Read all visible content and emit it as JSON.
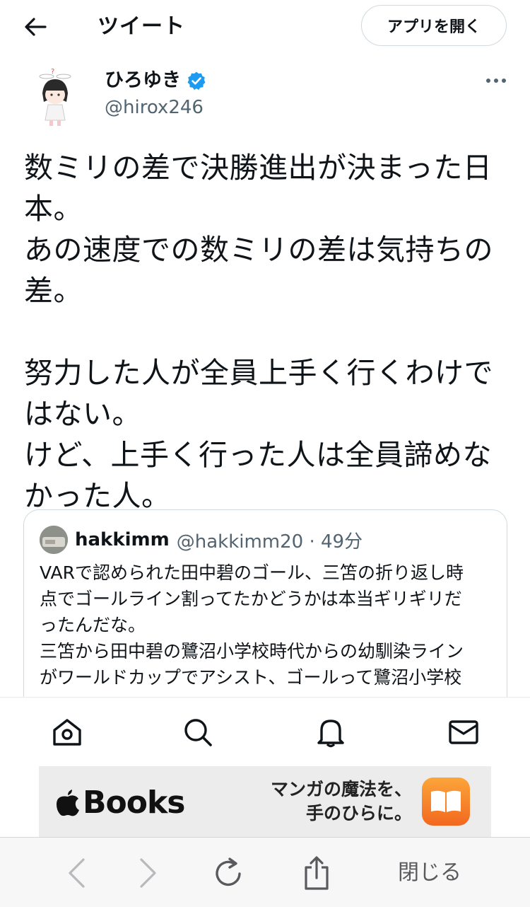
{
  "header": {
    "title": "ツイート",
    "open_app_label": "アプリを開く"
  },
  "author": {
    "name": "ひろゆき",
    "handle": "@hirox246",
    "verified": true
  },
  "tweet": {
    "lines": [
      "数ミリの差で決勝進出が決まった日",
      "本。",
      "あの速度での数ミリの差は気持ちの",
      "差。",
      "",
      "努力した人が全員上手く行くわけで",
      "はない。",
      "けど、上手く行った人は全員諦めな",
      "かった人。"
    ]
  },
  "quote": {
    "name": "hakkimm",
    "handle_time": "@hakkimm20 · 49分",
    "lines": [
      "VARで認められた田中碧のゴール、三笘の折り返し時",
      "点でゴールライン割ってたかどうかは本当ギリギリだ",
      "ったんだな。",
      "三笘から田中碧の鷺沼小学校時代からの幼馴染ライン",
      "がワールドカップでアシスト、ゴールって鷺沼小学校"
    ]
  },
  "nav": {
    "icons": [
      "home-icon",
      "search-icon",
      "notifications-icon",
      "messages-icon"
    ]
  },
  "ad": {
    "brand": "Books",
    "tagline_1": "マンガの魔法を、",
    "tagline_2": "手のひらに。",
    "app_icon_color": "#f7882a"
  },
  "browser_toolbar": {
    "close_label": "閉じる"
  },
  "colors": {
    "text": "#0f1419",
    "secondary_text": "#536471",
    "border": "#cfd9de",
    "verified_badge": "#1d9bf0"
  }
}
